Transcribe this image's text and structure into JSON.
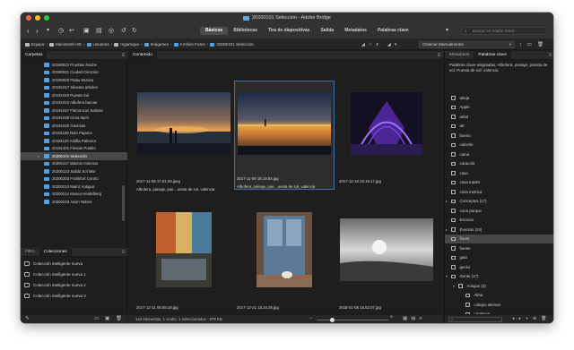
{
  "window": {
    "title": "20200101 Seleccion - Adobe Bridge",
    "traffic_colors": [
      "#ff5f57",
      "#febc2e",
      "#28c840"
    ]
  },
  "toolbar": {
    "workspaces": [
      "Básicos",
      "Bibliotecas",
      "Tira de diapositivas",
      "Salida",
      "Metadatos",
      "Palabras clave"
    ],
    "active_workspace": "Básicos",
    "search_placeholder": "Buscar en Adobe Stock"
  },
  "pathbar": {
    "crumbs": [
      "Equipo",
      "Macintosh HD",
      "Usuarios",
      "mgarrique",
      "Imágenes",
      "Archivo Fotos",
      "20200101 Seleccion"
    ],
    "sort_label": "Ordenar Manualmente"
  },
  "left_panel": {
    "tabs": [
      "Carpetas"
    ],
    "folders": [
      "20190823 Pruebas Noche",
      "20190921 Ciudad Ciencias",
      "20190929 Palau Musica",
      "20191017 Siluetas arboles",
      "20191020 Puesta Sol",
      "20191022 Albufera barcas",
      "20191027 Flamencos Salinas",
      "20191029 Cima Itach",
      "20191030 Gaviotas",
      "20191108 Nido Pajaros",
      "20191120 Ardilla Palmera",
      "20191201 Fiestas Pueblo",
      "20200101 Selección",
      "20200117 Macros Insectos",
      "20200123 Salida Sol Mar",
      "20200203 Frankfurt Centro",
      "20200210 Mainz Antiguo",
      "20200214 Museo Heidelberg",
      "20200218 Avion Nubes"
    ],
    "selected_folder": "20200101 Selección",
    "bottom_tabs": [
      "Filtro",
      "Colecciones"
    ],
    "active_bottom_tab": "Colecciones",
    "collections": [
      "Colección inteligente nueva",
      "Colección inteligente nueva 1",
      "Colección inteligente nueva 2",
      "Colección inteligente nueva 3"
    ]
  },
  "content": {
    "header": "Contenido",
    "items": [
      {
        "filename": "2017-11-09 17.51.09.jpeg",
        "keywords": "Albufera, paisaje, pue…uesta de sol, valencia"
      },
      {
        "filename": "2017-11-09 18.19.54.jpg",
        "keywords": "Albufera, paisaje, pue…uesta de sol, valencia"
      },
      {
        "filename": "2017-12-10 20.18.17.jpg",
        "keywords": ""
      },
      {
        "filename": "2017-12-11 09.59.18.jpg",
        "keywords": ""
      },
      {
        "filename": "2017-12-21 15.24.25.jpg",
        "keywords": ""
      },
      {
        "filename": "2018-01-06 15.52.07.jpg",
        "keywords": ""
      }
    ],
    "status": "144 elementos, 1 oculto, 1 seleccionados - 978 KB"
  },
  "right_panel": {
    "tabs": [
      "Metadatos",
      "Palabras clave"
    ],
    "active_tab": "Palabras clave",
    "assigned": "Palabras clave asignadas: Albufera; paisaje; puesta de sol; Puesta de sol; valencia",
    "keywords": [
      {
        "label": "abeja",
        "level": 0
      },
      {
        "label": "Apple",
        "level": 0
      },
      {
        "label": "arbol",
        "level": 0
      },
      {
        "label": "art",
        "level": 0
      },
      {
        "label": "bueno",
        "level": 0
      },
      {
        "label": "calcetin",
        "level": 0
      },
      {
        "label": "cama",
        "level": 0
      },
      {
        "label": "caracola",
        "level": 0
      },
      {
        "label": "casa",
        "level": 0
      },
      {
        "label": "casa madre",
        "level": 0
      },
      {
        "label": "cinta metrica",
        "level": 0
      },
      {
        "label": "Conceptos  (17)",
        "level": 0,
        "expand": "▸"
      },
      {
        "label": "cuna parque",
        "level": 0
      },
      {
        "label": "Escocia",
        "level": 0
      },
      {
        "label": "Eventos  (24)",
        "level": 0,
        "expand": "▸"
      },
      {
        "label": "flores",
        "level": 0,
        "highlight": true
      },
      {
        "label": "fuente",
        "level": 0
      },
      {
        "label": "gato",
        "level": 0
      },
      {
        "label": "gecko",
        "level": 0
      },
      {
        "label": "Gente  (17)",
        "level": 0,
        "expand": "▾"
      },
      {
        "label": "Amigos  (3)",
        "level": 1,
        "expand": "▾"
      },
      {
        "label": "Alina",
        "level": 2
      },
      {
        "label": "colegio aleman",
        "level": 2
      },
      {
        "label": "creativos",
        "level": 2
      }
    ]
  }
}
